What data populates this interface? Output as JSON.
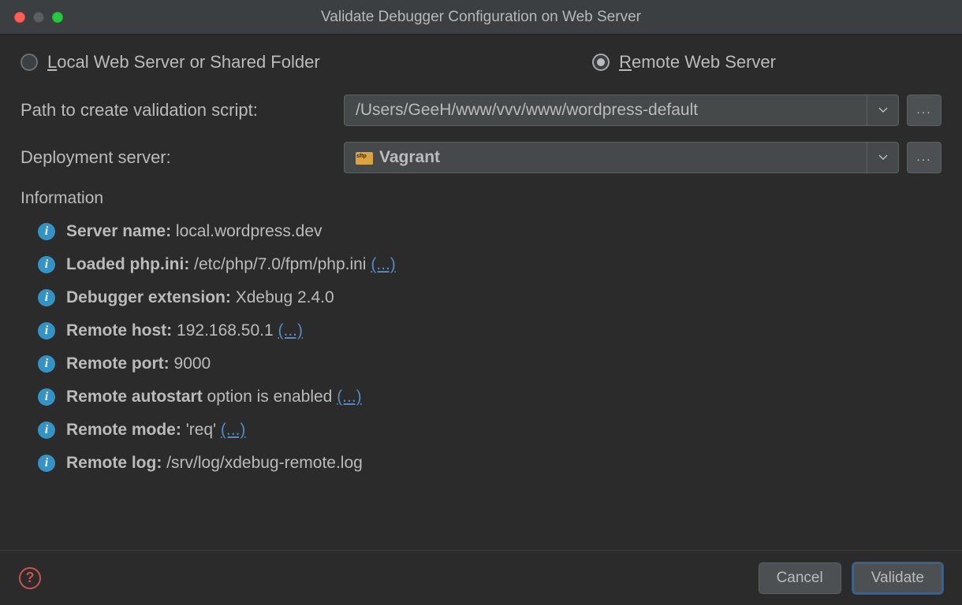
{
  "window": {
    "title": "Validate Debugger Configuration on Web Server"
  },
  "radios": {
    "local_label": "Local Web Server or Shared Folder",
    "remote_label": "Remote Web Server",
    "selected": "remote"
  },
  "form": {
    "path_label": "Path to create validation script:",
    "path_value": "/Users/GeeH/www/vvv/www/wordpress-default",
    "deploy_label": "Deployment server:",
    "deploy_value": "Vagrant"
  },
  "section_header": "Information",
  "info": [
    {
      "label": "Server name:",
      "value": "local.wordpress.dev",
      "link": null
    },
    {
      "label": "Loaded php.ini:",
      "value": "/etc/php/7.0/fpm/php.ini",
      "link": "(...)"
    },
    {
      "label": "Debugger extension:",
      "value": "Xdebug 2.4.0",
      "link": null
    },
    {
      "label": "Remote host:",
      "value": "192.168.50.1",
      "link": "(...)"
    },
    {
      "label": "Remote port:",
      "value": "9000",
      "link": null
    },
    {
      "label": "Remote autostart",
      "value": "option is enabled",
      "link": "(...)"
    },
    {
      "label": "Remote mode:",
      "value": "'req'",
      "link": "(...)"
    },
    {
      "label": "Remote log:",
      "value": "/srv/log/xdebug-remote.log",
      "link": null
    }
  ],
  "buttons": {
    "cancel": "Cancel",
    "validate": "Validate",
    "browse": "..."
  }
}
